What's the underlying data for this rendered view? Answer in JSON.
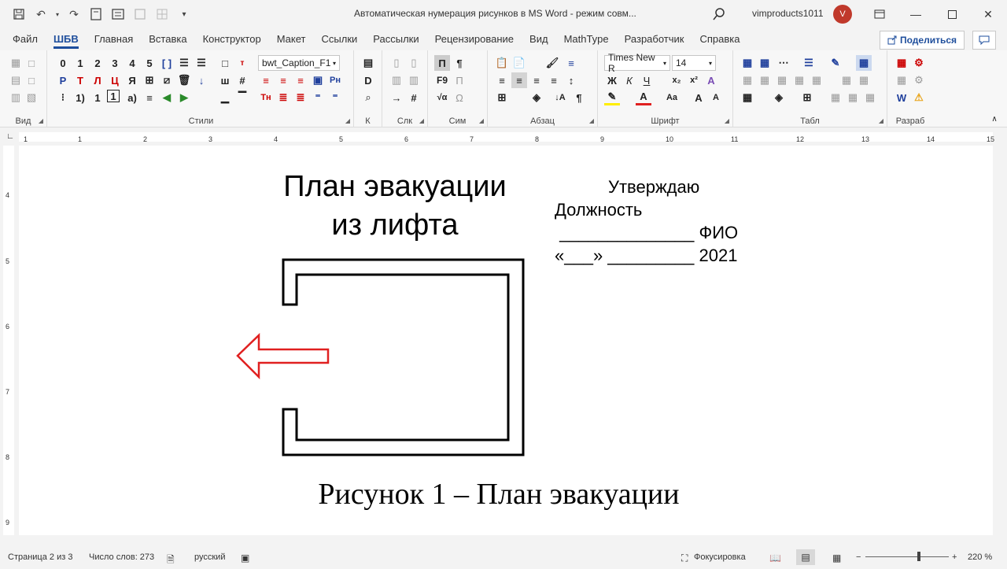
{
  "window": {
    "title": "Автоматическая нумерация рисунков в MS Word  -  режим совм...",
    "user": "vimproducts1011",
    "avatar_letter": "V"
  },
  "tabs": [
    {
      "label": "Файл"
    },
    {
      "label": "ШБВ"
    },
    {
      "label": "Главная"
    },
    {
      "label": "Вставка"
    },
    {
      "label": "Конструктор"
    },
    {
      "label": "Макет"
    },
    {
      "label": "Ссылки"
    },
    {
      "label": "Рассылки"
    },
    {
      "label": "Рецензирование"
    },
    {
      "label": "Вид"
    },
    {
      "label": "MathType"
    },
    {
      "label": "Разработчик"
    },
    {
      "label": "Справка"
    }
  ],
  "share_label": "Поделиться",
  "ribbon": {
    "groups": {
      "vid": "Вид",
      "styles": "Стили",
      "k": "К",
      "slk": "Слк",
      "sim": "Сим",
      "abzac": "Абзац",
      "shrift": "Шрифт",
      "tabl": "Табл",
      "razrab": "Разраб"
    },
    "style_combo": "bwt_Caption_F1",
    "font_name": "Times New R",
    "font_size": "14",
    "style_row1": [
      "0",
      "1",
      "2",
      "3",
      "4",
      "5"
    ],
    "style_row2": [
      "Р",
      "Т",
      "Л",
      "Ц",
      "Я"
    ],
    "style_row3": [
      "1)",
      "1",
      "1",
      "а)"
    ]
  },
  "ruler": {
    "numbers": [
      "1",
      "1",
      "2",
      "3",
      "4",
      "5",
      "6",
      "7",
      "8",
      "9",
      "10",
      "11",
      "12",
      "13",
      "14",
      "15"
    ],
    "v_numbers": [
      "4",
      "5",
      "6",
      "7",
      "8",
      "9"
    ]
  },
  "document": {
    "heading_line1": "План эвакуации",
    "heading_line2": "из лифта",
    "approve": "Утверждаю",
    "position": "Должность",
    "fio_line": " ______________ ФИО",
    "date_line": "«___» _________ 2021",
    "caption": "Рисунок 1 – План эвакуации"
  },
  "status": {
    "page": "Страница 2 из 3",
    "words": "Число слов: 273",
    "language": "русский",
    "focus": "Фокусировка",
    "zoom": "220 %"
  },
  "colors": {
    "accent": "#1e4e9c",
    "arrow": "#e02020",
    "avatar": "#c0392b"
  }
}
